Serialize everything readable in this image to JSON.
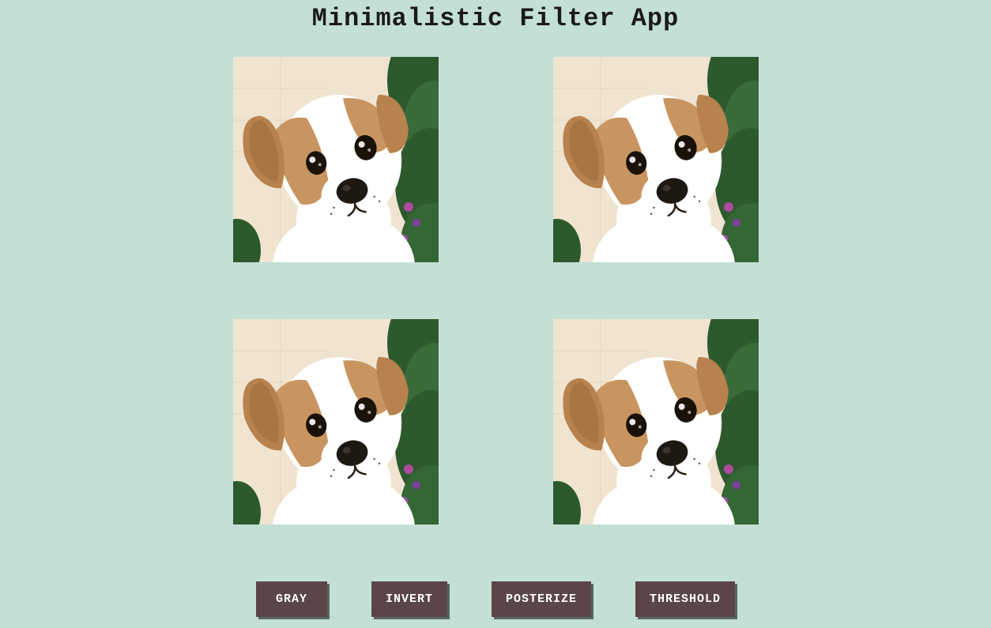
{
  "title": "Minimalistic Filter App",
  "images": [
    {
      "name": "image-top-left"
    },
    {
      "name": "image-top-right"
    },
    {
      "name": "image-bottom-left"
    },
    {
      "name": "image-bottom-right"
    }
  ],
  "buttons": {
    "gray": "GRAY",
    "invert": "INVERT",
    "posterize": "POSTERIZE",
    "threshold": "THRESHOLD"
  }
}
